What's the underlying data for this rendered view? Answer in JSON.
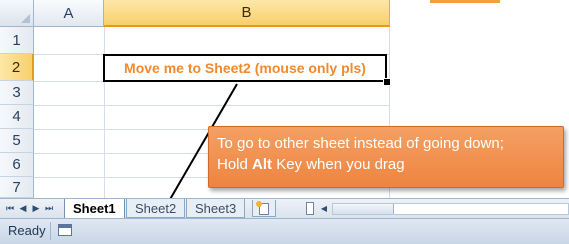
{
  "grid": {
    "columns": [
      "A",
      "B"
    ],
    "rows": [
      "1",
      "2",
      "3",
      "4",
      "5",
      "6",
      "7"
    ],
    "selected_column": "B",
    "selected_row": "2",
    "active_cell_text": "Move me to Sheet2 (mouse only pls)",
    "active_cell_color": "#f28a2c"
  },
  "callout": {
    "line1": "To go to other sheet instead of going down;",
    "line2_prefix": "Hold ",
    "line2_bold": "Alt",
    "line2_suffix": " Key when you drag",
    "background": "#ee8440"
  },
  "tabs": {
    "nav_first": "⏮",
    "nav_prev": "◀",
    "nav_next": "▶",
    "nav_last": "⏭",
    "items": [
      {
        "label": "Sheet1",
        "active": true
      },
      {
        "label": "Sheet2",
        "active": false
      },
      {
        "label": "Sheet3",
        "active": false
      }
    ],
    "insert_sheet_icon": "insert-worksheet-icon"
  },
  "status": {
    "text": "Ready",
    "macro_icon": "record-macro-icon"
  }
}
